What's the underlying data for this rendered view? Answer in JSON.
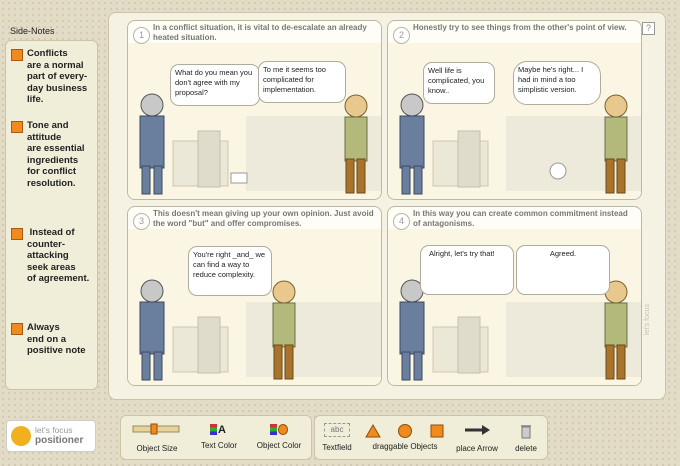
{
  "sidebar": {
    "title": "Side-Notes",
    "notes": [
      {
        "text": "Conflicts\nare a normal\npart of every-\nday business\nlife."
      },
      {
        "text": "Tone and\nattitude\nare essential\ningredients\nfor conflict\nresolution."
      },
      {
        "text": " Instead of\ncounter-\nattacking\nseek areas\nof agreement."
      },
      {
        "text": "Always\nend on a\npositive note"
      }
    ]
  },
  "panels": [
    {
      "num": "1",
      "title": "In a conflict situation, it is vital to de-escalate an already heated situation.",
      "bubbles": [
        "What do you mean you don't agree with my proposal?",
        "To me it seems too complicated for implementation."
      ]
    },
    {
      "num": "2",
      "title": "Honestly try to see things from the other's point of view.",
      "bubbles": [
        "Well life is complicated, you know..",
        "Maybe he's right... I had in mind a too simplistic version."
      ]
    },
    {
      "num": "3",
      "title": "This doesn't mean giving up your own opinion. Just avoid the word \"but\" and offer compromises.",
      "bubbles": [
        "You're right _and_ we can  find a way to reduce complexity."
      ]
    },
    {
      "num": "4",
      "title": "In this way you can create common commitment instead of antagonisms.",
      "bubbles": [
        "Alright, let's try that!",
        "Agreed."
      ]
    }
  ],
  "help_label": "?",
  "watermark": "let's focus",
  "logo": {
    "line1": "let's focus",
    "line2": "positioner"
  },
  "toolbar": {
    "object_size": "Object Size",
    "text_color": "Text Color",
    "object_color": "Object Color",
    "textfield": "Textfield",
    "textfield_sample": "abc",
    "text_color_sample": "A",
    "draggable": "draggable Objects",
    "place_arrow": "place Arrow",
    "delete": "delete"
  },
  "colors": {
    "accent": "#f08a1c",
    "suit": "#6a7f9e",
    "shirt": "#b2b97a",
    "pants": "#a8742c"
  }
}
